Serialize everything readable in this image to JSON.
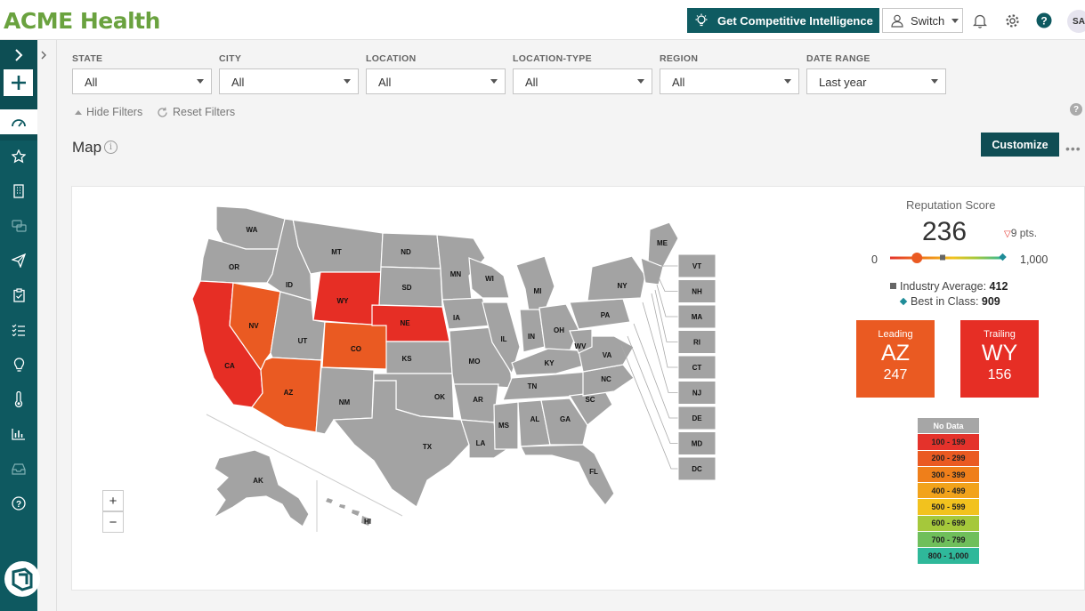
{
  "app": {
    "title": "ACME Health"
  },
  "topbar": {
    "gci_label": "Get Competitive Intelligence",
    "switch_label": "Switch",
    "avatar_initials": "SA"
  },
  "filters": [
    {
      "label": "STATE",
      "value": "All"
    },
    {
      "label": "CITY",
      "value": "All"
    },
    {
      "label": "LOCATION",
      "value": "All"
    },
    {
      "label": "LOCATION-TYPE",
      "value": "All"
    },
    {
      "label": "REGION",
      "value": "All"
    },
    {
      "label": "DATE RANGE",
      "value": "Last year"
    }
  ],
  "filter_controls": {
    "hide": "Hide Filters",
    "reset": "Reset Filters"
  },
  "map": {
    "title": "Map",
    "customize_label": "Customize",
    "zoom_in": "+",
    "zoom_out": "−",
    "state_labels": {
      "WA": "WA",
      "OR": "OR",
      "CA": "CA",
      "NV": "NV",
      "ID": "ID",
      "MT": "MT",
      "WY": "WY",
      "UT": "UT",
      "AZ": "AZ",
      "CO": "CO",
      "NM": "NM",
      "ND": "ND",
      "SD": "SD",
      "NE": "NE",
      "KS": "KS",
      "OK": "OK",
      "TX": "TX",
      "MN": "MN",
      "IA": "IA",
      "MO": "MO",
      "AR": "AR",
      "LA": "LA",
      "WI": "WI",
      "IL": "IL",
      "MI": "MI",
      "IN": "IN",
      "OH": "OH",
      "KY": "KY",
      "TN": "TN",
      "MS": "MS",
      "AL": "AL",
      "GA": "GA",
      "FL": "FL",
      "SC": "SC",
      "NC": "NC",
      "VA": "VA",
      "WV": "WV",
      "PA": "PA",
      "NY": "NY",
      "ME": "ME",
      "AK": "AK",
      "HI": "HI"
    },
    "small_states": [
      "VT",
      "NH",
      "MA",
      "RI",
      "CT",
      "NJ",
      "DE",
      "MD",
      "DC"
    ],
    "colors": {
      "gray": "#a3a3a3",
      "red": "#e62e25",
      "orange": "#ea5a22"
    }
  },
  "reputation": {
    "title": "Reputation Score",
    "score": "236",
    "change": "9 pts.",
    "min": "0",
    "max": "1,000",
    "score_fraction": 0.236,
    "industry_label": "Industry Average:",
    "industry_value": "412",
    "best_label": "Best in Class:",
    "best_value": "909",
    "leading_label": "Leading",
    "leading_state": "AZ",
    "leading_value": "247",
    "trailing_label": "Trailing",
    "trailing_state": "WY",
    "trailing_value": "156"
  },
  "legend": [
    {
      "label": "No Data",
      "color": "#a6a6a6"
    },
    {
      "label": "100 - 199",
      "color": "#e4322b"
    },
    {
      "label": "200 - 299",
      "color": "#ea5a22"
    },
    {
      "label": "300 - 399",
      "color": "#ef7f1a"
    },
    {
      "label": "400 - 499",
      "color": "#f2a31b"
    },
    {
      "label": "500 - 599",
      "color": "#f2c21e"
    },
    {
      "label": "600 - 699",
      "color": "#a5c83b"
    },
    {
      "label": "700 - 799",
      "color": "#6fbf5b"
    },
    {
      "label": "800 - 1,000",
      "color": "#2fb89a"
    }
  ]
}
